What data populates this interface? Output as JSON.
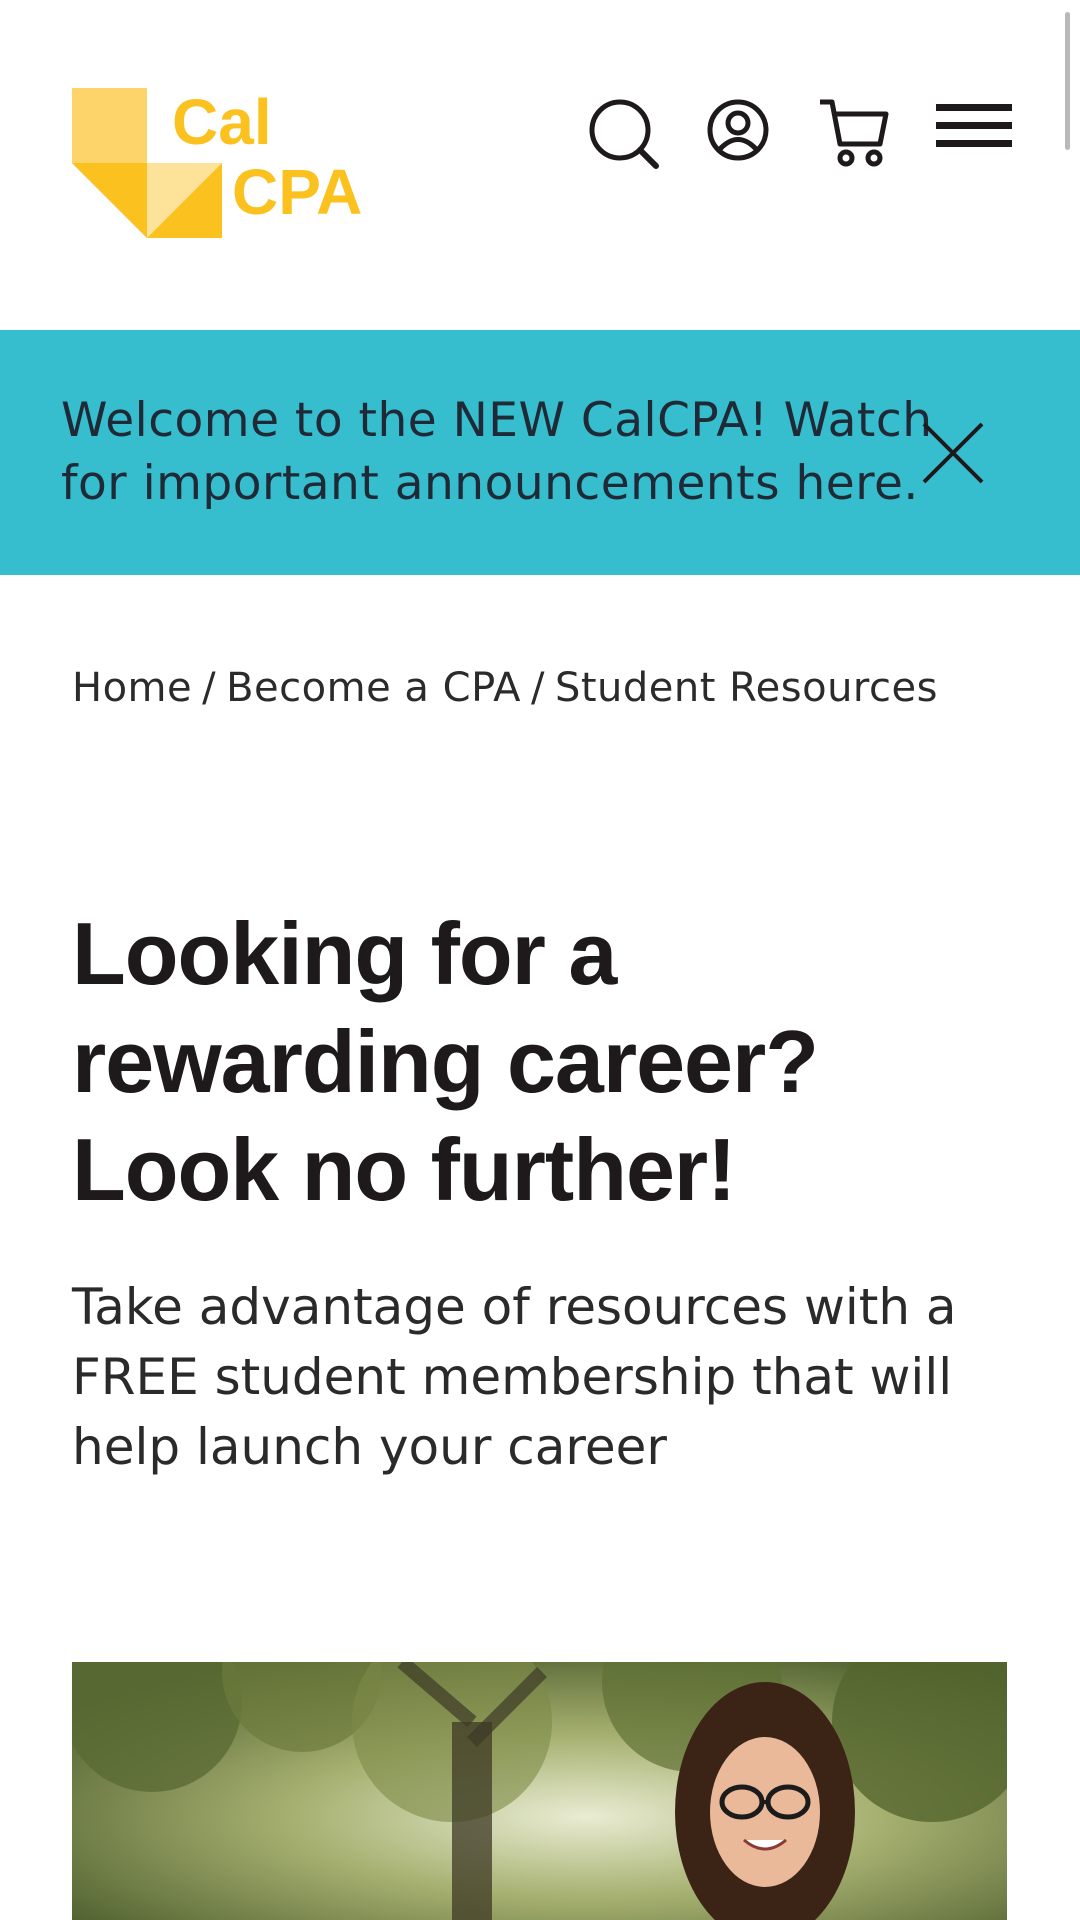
{
  "header": {
    "logo_alt": "CalCPA",
    "logo_line1": "Cal",
    "logo_line2": "CPA",
    "icons": [
      "search-icon",
      "account-icon",
      "cart-icon",
      "menu-icon"
    ]
  },
  "banner": {
    "text": "Welcome to the NEW CalCPA! Watch for important announcements here.",
    "close_icon": "close-icon"
  },
  "breadcrumb": {
    "items": [
      "Home",
      "Become a CPA",
      "Student Resources"
    ],
    "separator": "/"
  },
  "main": {
    "headline": "Looking for a rewarding career? Look no further!",
    "subhead": "Take advantage of resources with a FREE student membership that will help launch your career"
  },
  "colors": {
    "brand_yellow": "#fbc21f",
    "banner_teal": "#36bdce",
    "text_dark": "#231f20"
  }
}
